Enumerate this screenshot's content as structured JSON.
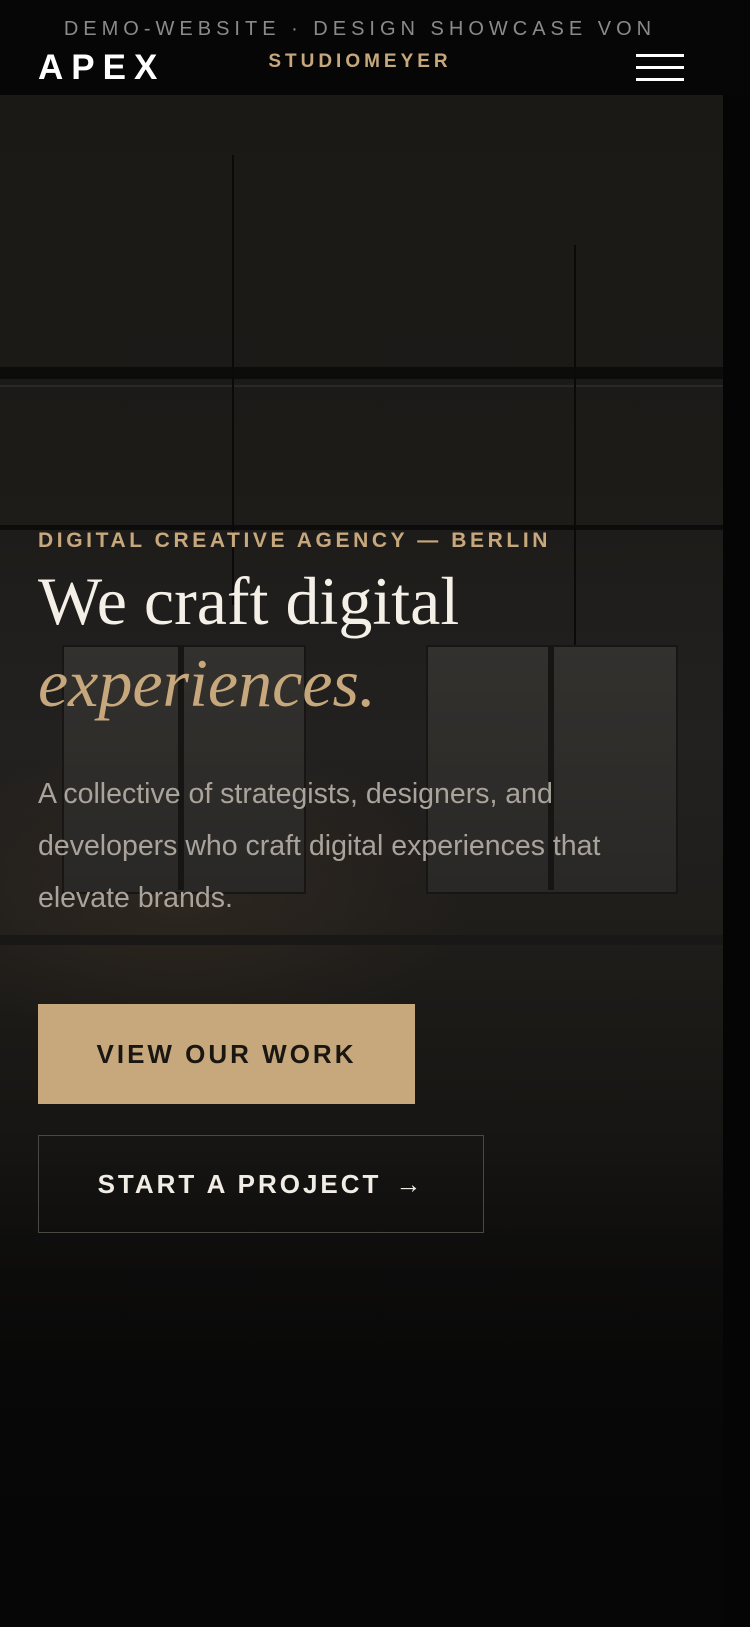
{
  "header": {
    "logo": "APEX",
    "demo_notice_line1": "DEMO-WEBSITE · DESIGN SHOWCASE VON",
    "demo_notice_line2": "STUDIOMEYER",
    "menu_icon": "hamburger-menu-icon"
  },
  "hero": {
    "kicker": "DIGITAL CREATIVE AGENCY — BERLIN",
    "headline_line1": "We craft digital",
    "headline_accent": "experiences.",
    "lede": "A collective of strategists, designers, and developers who craft digital experiences that elevate brands.",
    "primary_cta": "VIEW OUR WORK",
    "secondary_cta": "START A PROJECT",
    "secondary_cta_icon": "→"
  },
  "colors": {
    "accent": "#c7a87c",
    "background": "#060606",
    "text": "#f1ece4",
    "muted_text": "#a9a39b"
  }
}
